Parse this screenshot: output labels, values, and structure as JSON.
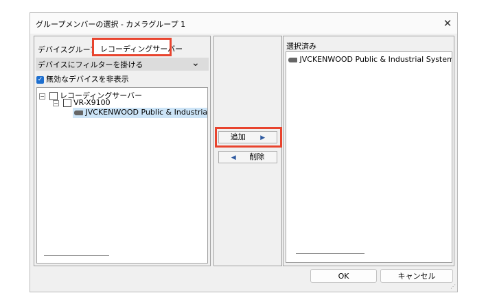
{
  "window": {
    "title": "グループメンバーの選択 - カメラグループ 1",
    "close_glyph": "✕"
  },
  "left": {
    "tabs": [
      {
        "label": "デバイスグループ"
      },
      {
        "label": "レコーディングサーバー"
      }
    ],
    "filter_label": "デバイスにフィルターを掛ける",
    "checkbox": {
      "label": "無効なデバイスを非表示",
      "checked": true
    },
    "tree": {
      "root": {
        "label": "レコーディングサーバー",
        "expander": "−",
        "icon": "server-group-icon"
      },
      "server": {
        "label": "VR-X9100",
        "expander": "−",
        "icon": "server-icon"
      },
      "camera": {
        "label": "JVCKENWOOD Public & Industrial Sy",
        "icon": "camera-icon"
      }
    }
  },
  "middle": {
    "add_label": "追加",
    "add_arrow": "▶",
    "remove_label": "削除",
    "remove_arrow": "◀"
  },
  "right": {
    "header": "選択済み",
    "items": [
      {
        "label": "JVCKENWOOD Public & Industrial Systems Co",
        "icon": "camera-icon"
      }
    ]
  },
  "footer": {
    "ok_label": "OK",
    "cancel_label": "キャンセル"
  },
  "colors": {
    "highlight": "#e8442e",
    "accent": "#1d6fcf",
    "selection": "#cce4f7"
  }
}
